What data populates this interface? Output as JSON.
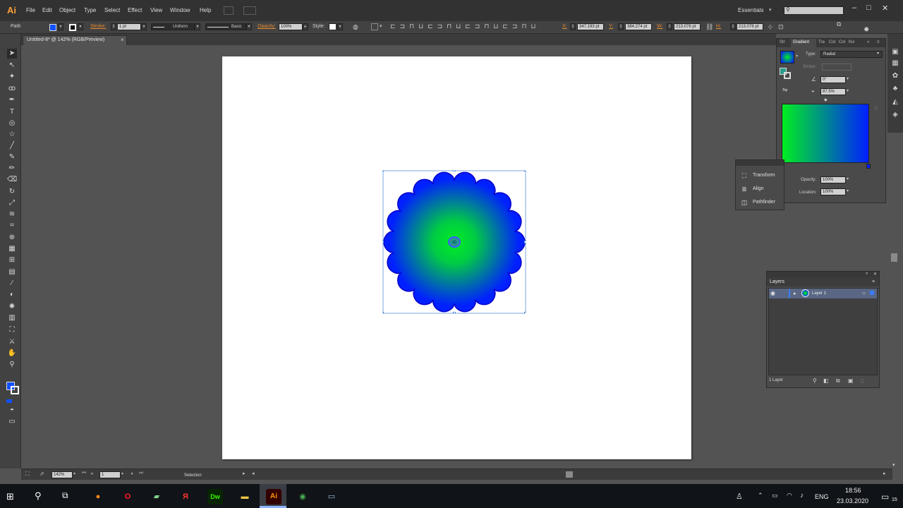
{
  "app": {
    "logo": "Ai",
    "menu": [
      "File",
      "Edit",
      "Object",
      "Type",
      "Select",
      "Effect",
      "View",
      "Window",
      "Help"
    ],
    "workspace": "Essentials",
    "window_controls": {
      "minimize": "–",
      "maximize": "□",
      "close": "✕"
    }
  },
  "control_bar": {
    "object_type": "Path",
    "stroke_label": "Stroke:",
    "stroke_weight": "1 pt",
    "profile": "Uniform",
    "brush": "Basic",
    "opacity_label": "Opacity:",
    "opacity_value": "100%",
    "style_label": "Style:",
    "x_label": "X:",
    "x_value": "347.193 pt",
    "y_label": "Y:",
    "y_value": "384.274 pt",
    "w_label": "W:",
    "w_value": "213.076 pt",
    "h_label": "H:",
    "h_value": "213.076 pt"
  },
  "document": {
    "tab_title": "Untitled-8* @ 142% (RGB/Preview)",
    "close_glyph": "×"
  },
  "gradient_panel": {
    "tabs": [
      "Str",
      "Gradient",
      "Tra",
      "Col",
      "Col",
      "Kix"
    ],
    "active_tab": "Gradient",
    "type_label": "Type:",
    "type_value": "Radial",
    "stroke_label": "Stroke:",
    "angle_value": "0°",
    "aspect_value": "87.5%",
    "opacity_label": "Opacity:",
    "opacity_value": "100%",
    "location_label": "Location:",
    "location_value": "100%",
    "colors": {
      "start": "#00ee22",
      "end": "#0020ff"
    }
  },
  "mini_panel": {
    "items": [
      {
        "label": "Transform",
        "icon": "transform-icon"
      },
      {
        "label": "Align",
        "icon": "align-icon"
      },
      {
        "label": "Pathfinder",
        "icon": "pathfinder-icon"
      }
    ]
  },
  "layers_panel": {
    "tab": "Layers",
    "layer_name": "Layer 1",
    "footer": "1 Layer"
  },
  "status_bar": {
    "zoom": "142%",
    "artboard": "1",
    "tool": "Selection"
  },
  "taskbar": {
    "apps": [
      {
        "name": "firefox",
        "glyph": "●",
        "color": "#ff8a1c"
      },
      {
        "name": "opera",
        "glyph": "O",
        "color": "#ff1b2d"
      },
      {
        "name": "notes",
        "glyph": "▰",
        "color": "#7fd08a"
      },
      {
        "name": "yandex",
        "glyph": "Я",
        "color": "#ff3333"
      },
      {
        "name": "dreamweaver",
        "glyph": "Dw",
        "color": "#35fa00"
      },
      {
        "name": "explorer",
        "glyph": "▬",
        "color": "#f3c744"
      },
      {
        "name": "illustrator",
        "glyph": "Ai",
        "color": "#ff9a00"
      },
      {
        "name": "chrome",
        "glyph": "◉",
        "color": "#4caf50"
      },
      {
        "name": "remote",
        "glyph": "▭",
        "color": "#9fb9d6"
      }
    ],
    "lang": "ENG",
    "time": "18:56",
    "date": "23.03.2020",
    "notifications": "15"
  }
}
